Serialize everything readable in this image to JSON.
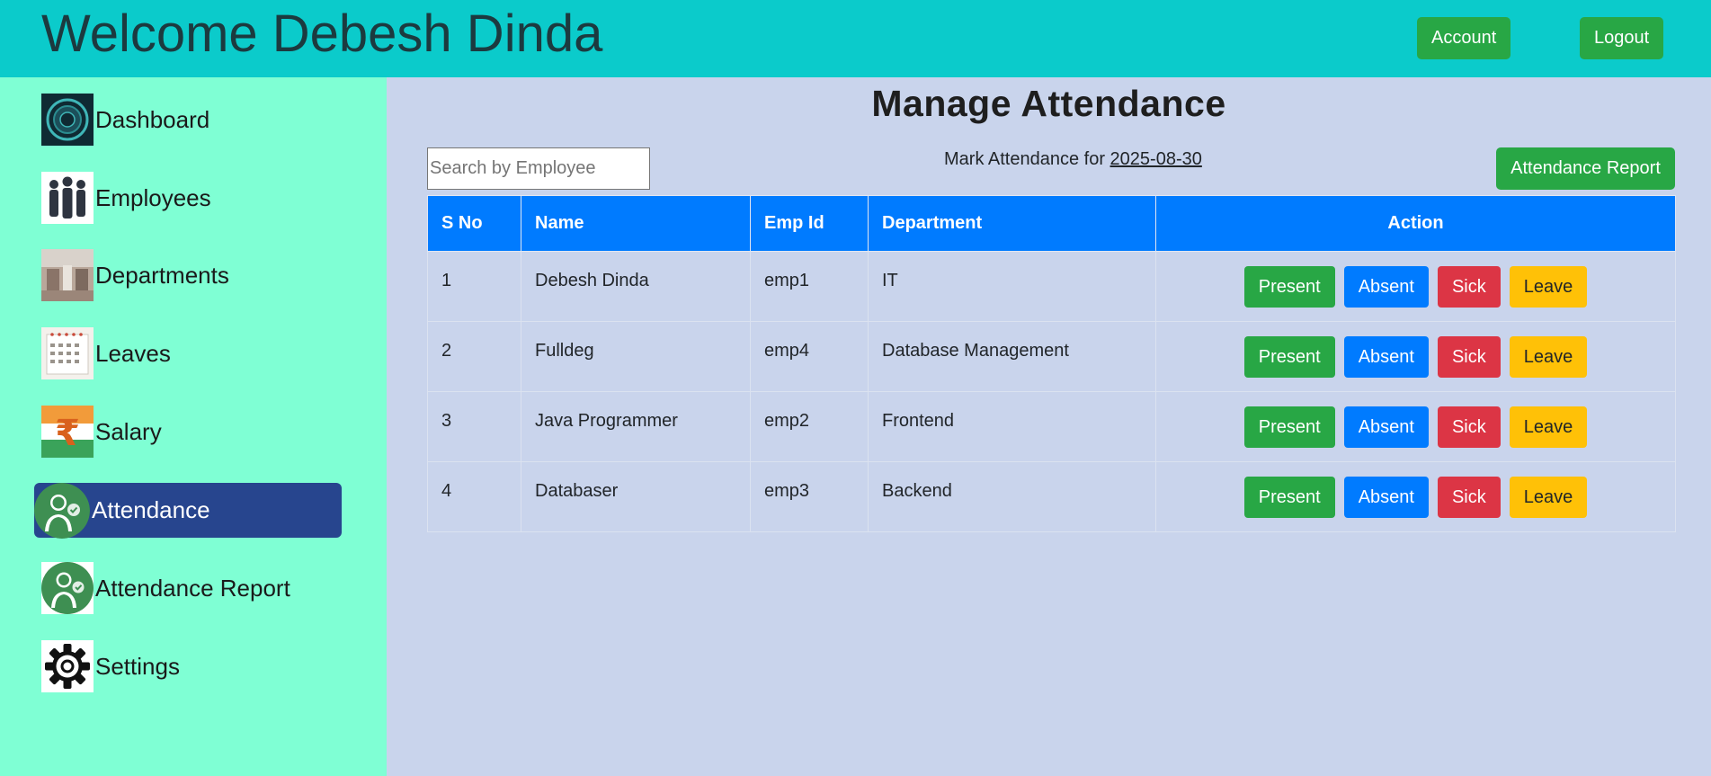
{
  "header": {
    "welcome": "Welcome Debesh Dinda",
    "account_label": "Account",
    "logout_label": "Logout"
  },
  "sidebar": {
    "items": [
      {
        "label": "Dashboard",
        "icon": "dashboard-icon"
      },
      {
        "label": "Employees",
        "icon": "employees-icon"
      },
      {
        "label": "Departments",
        "icon": "departments-icon"
      },
      {
        "label": "Leaves",
        "icon": "calendar-icon"
      },
      {
        "label": "Salary",
        "icon": "rupee-icon"
      },
      {
        "label": "Attendance",
        "icon": "attendance-icon",
        "active": true
      },
      {
        "label": "Attendance Report",
        "icon": "attendance-report-icon"
      },
      {
        "label": "Settings",
        "icon": "gear-icon"
      }
    ]
  },
  "main": {
    "title": "Manage Attendance",
    "search_placeholder": "Search by Employee",
    "mark_prefix": "Mark Attendance for",
    "mark_date": "2025-08-30",
    "report_button": "Attendance Report",
    "table": {
      "headers": [
        "S No",
        "Name",
        "Emp Id",
        "Department",
        "Action"
      ],
      "rows": [
        {
          "sno": "1",
          "name": "Debesh Dinda",
          "emp_id": "emp1",
          "department": "IT"
        },
        {
          "sno": "2",
          "name": "Fulldeg",
          "emp_id": "emp4",
          "department": "Database Management"
        },
        {
          "sno": "3",
          "name": "Java Programmer",
          "emp_id": "emp2",
          "department": "Frontend"
        },
        {
          "sno": "4",
          "name": "Databaser",
          "emp_id": "emp3",
          "department": "Backend"
        }
      ],
      "actions": [
        "Present",
        "Absent",
        "Sick",
        "Leave"
      ]
    }
  },
  "colors": {
    "header_bg": "#0bcbcb",
    "sidebar_bg": "#7fffd4",
    "main_bg": "#c9d4ec",
    "active_nav": "#27458e",
    "table_header": "#007bff",
    "present": "#28a745",
    "absent": "#007bff",
    "sick": "#dc3545",
    "leave": "#ffc107"
  }
}
